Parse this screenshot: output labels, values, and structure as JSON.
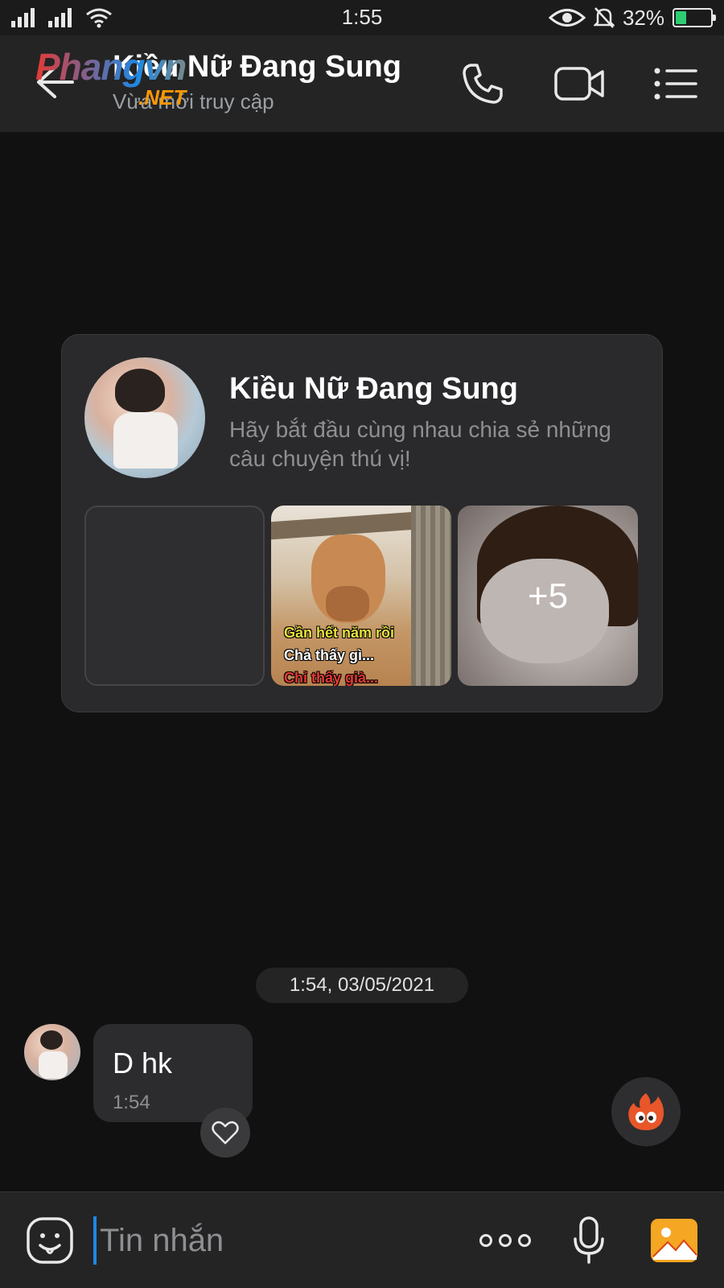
{
  "status_bar": {
    "time": "1:55",
    "battery_percent": "32%",
    "battery_level": 0.32
  },
  "header": {
    "title": "Kiều Nữ Đang Sung",
    "subtitle": "Vừa mới truy cập",
    "watermark_line1": "Phangvn",
    "watermark_line2": ".NET",
    "icons": [
      "back-arrow-icon",
      "phone-icon",
      "video-call-icon",
      "menu-list-icon"
    ]
  },
  "profile_card": {
    "name": "Kiều Nữ Đang Sung",
    "description": "Hãy bắt đầu cùng nhau chia sẻ những câu chuyện thú vị!",
    "meme_lines": [
      "Gần hết năm rồi",
      "Chả thấy gì...",
      "Chỉ thấy già..."
    ],
    "more_count": "+5"
  },
  "conversation": {
    "date_separator": "1:54, 03/05/2021",
    "messages": [
      {
        "text": "D hk",
        "time": "1:54"
      }
    ]
  },
  "input_bar": {
    "placeholder": "Tin nhắn",
    "icons": [
      "emoji-sticker-icon",
      "more-options-icon",
      "microphone-icon",
      "gallery-icon"
    ]
  },
  "colors": {
    "background": "#111111",
    "header_bg": "#242424",
    "card_bg": "#2a2a2c",
    "bubble_bg": "#2c2c2e",
    "accent_cursor": "#1e88e5",
    "battery_green": "#2ecc71",
    "gallery_orange": "#f5a623"
  }
}
